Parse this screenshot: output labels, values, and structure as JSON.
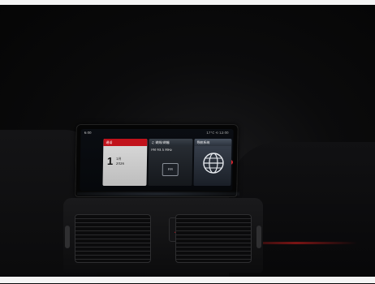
{
  "status_bar": {
    "left": "6:00",
    "right": "17°C ⟲ 12:00"
  },
  "tiles": [
    {
      "header": "通话",
      "big": "1",
      "line1": "1月",
      "line2": "2026"
    },
    {
      "header": "♫ 调频/调幅",
      "line1": "FM 93.5 MHz",
      "logo": "FM"
    },
    {
      "header": "导航系统"
    }
  ],
  "colors": {
    "accent_red": "#c1121b",
    "hazard_red": "#d11a22"
  }
}
